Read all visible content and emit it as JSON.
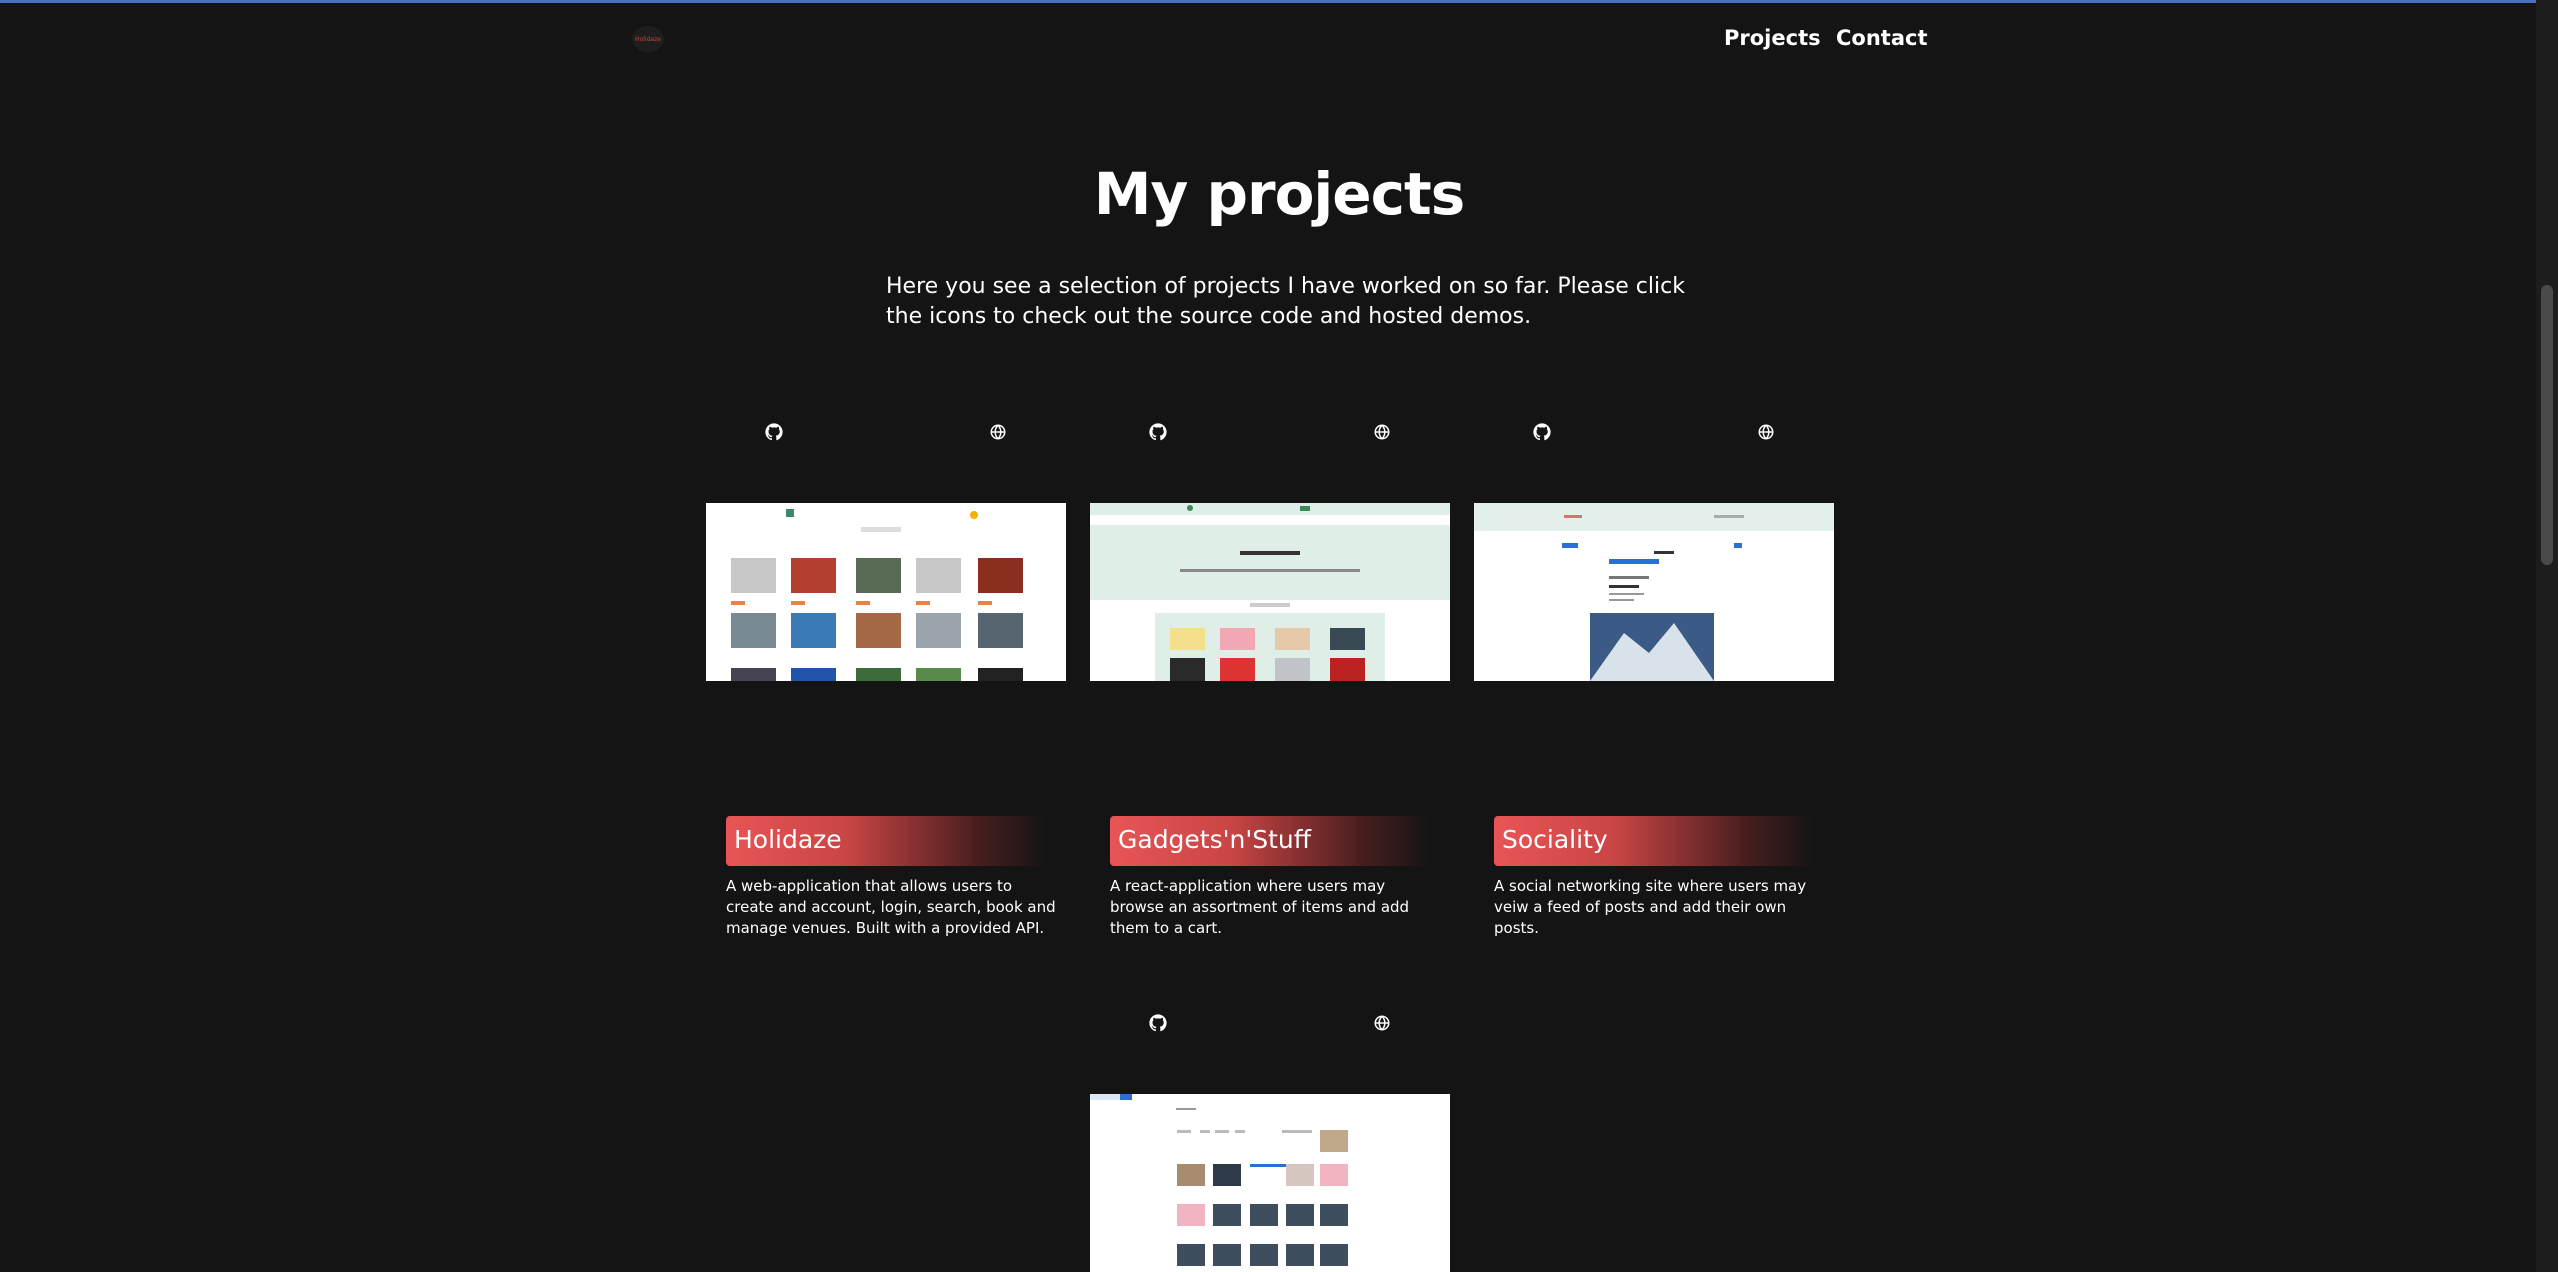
{
  "header": {
    "logo_text": "Holidaze",
    "nav": [
      {
        "label": "Projects"
      },
      {
        "label": "Contact"
      }
    ]
  },
  "main": {
    "title": "My projects",
    "intro": "Here you see a selection of projects I have worked on so far. Please click the icons to check out the source code and hosted demos."
  },
  "projects": [
    {
      "title": "Holidaze",
      "description": "A web-application that allows users to create and account, login, search, book and manage venues. Built with a provided API.",
      "icons": [
        "github-icon",
        "globe-icon"
      ]
    },
    {
      "title": "Gadgets'n'Stuff",
      "description": "A react-application where users may browse an assortment of items and add them to a cart.",
      "icons": [
        "github-icon",
        "globe-icon"
      ]
    },
    {
      "title": "Sociality",
      "description": "A social networking site where users may veiw a feed of posts and add their own posts.",
      "icons": [
        "github-icon",
        "globe-icon"
      ]
    },
    {
      "title": "",
      "description": "",
      "icons": [
        "github-icon",
        "globe-icon"
      ]
    }
  ],
  "colors": {
    "background": "#141414",
    "accent": "#e85555",
    "top_line": "#4a6fc0"
  }
}
